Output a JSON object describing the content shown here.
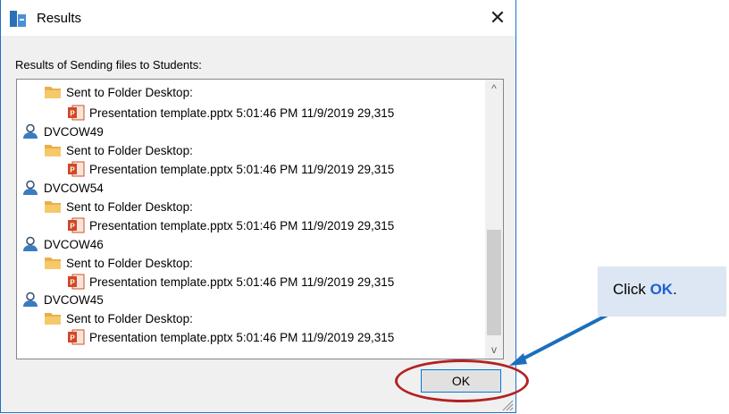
{
  "window": {
    "title": "Results",
    "caption": "Results of Sending files to Students:",
    "ok_label": "OK"
  },
  "list": {
    "folder_label": "Sent to Folder Desktop:",
    "file_entry": "Presentation template.pptx 5:01:46 PM 11/9/2019 29,315",
    "students": [
      "DVCOW49",
      "DVCOW54",
      "DVCOW46",
      "DVCOW45"
    ]
  },
  "scrollbar": {
    "up_glyph": "^",
    "down_glyph": "v"
  },
  "callout": {
    "prefix": "Click ",
    "emphasis": "OK",
    "suffix": "."
  },
  "colors": {
    "accent": "#1e6fc8",
    "highlight_ring": "#b22222",
    "callout_bg": "#dde7f3",
    "arrow": "#1a6fbd"
  }
}
